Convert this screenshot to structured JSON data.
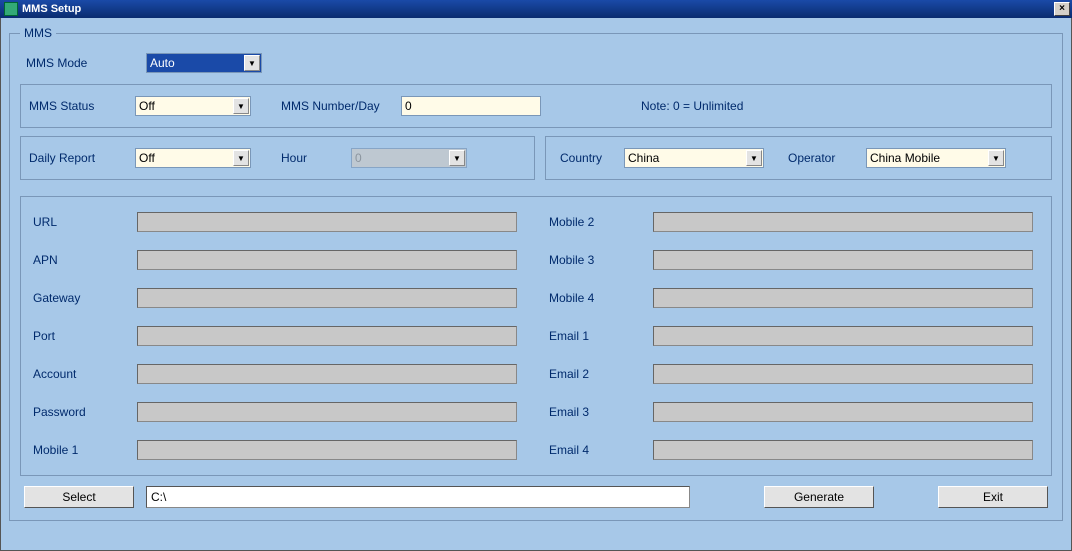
{
  "window": {
    "title": "MMS Setup"
  },
  "group": {
    "legend": "MMS"
  },
  "mms_mode": {
    "label": "MMS Mode",
    "value": "Auto"
  },
  "status_box": {
    "mms_status_label": "MMS Status",
    "mms_status_value": "Off",
    "mms_number_label": "MMS Number/Day",
    "mms_number_value": "0",
    "note": "Note: 0 = Unlimited"
  },
  "daily_box": {
    "daily_report_label": "Daily Report",
    "daily_report_value": "Off",
    "hour_label": "Hour",
    "hour_value": "0",
    "country_label": "Country",
    "country_value": "China",
    "operator_label": "Operator",
    "operator_value": "China Mobile"
  },
  "fields_left": [
    {
      "label": "URL",
      "value": ""
    },
    {
      "label": "APN",
      "value": ""
    },
    {
      "label": "Gateway",
      "value": ""
    },
    {
      "label": "Port",
      "value": ""
    },
    {
      "label": "Account",
      "value": ""
    },
    {
      "label": "Password",
      "value": ""
    },
    {
      "label": "Mobile 1",
      "value": ""
    }
  ],
  "fields_right": [
    {
      "label": "Mobile 2",
      "value": ""
    },
    {
      "label": "Mobile 3",
      "value": ""
    },
    {
      "label": "Mobile 4",
      "value": ""
    },
    {
      "label": "Email 1",
      "value": ""
    },
    {
      "label": "Email 2",
      "value": ""
    },
    {
      "label": "Email 3",
      "value": ""
    },
    {
      "label": "Email 4",
      "value": ""
    }
  ],
  "bottom": {
    "select_btn": "Select",
    "path_value": "C:\\",
    "generate_btn": "Generate",
    "exit_btn": "Exit"
  }
}
